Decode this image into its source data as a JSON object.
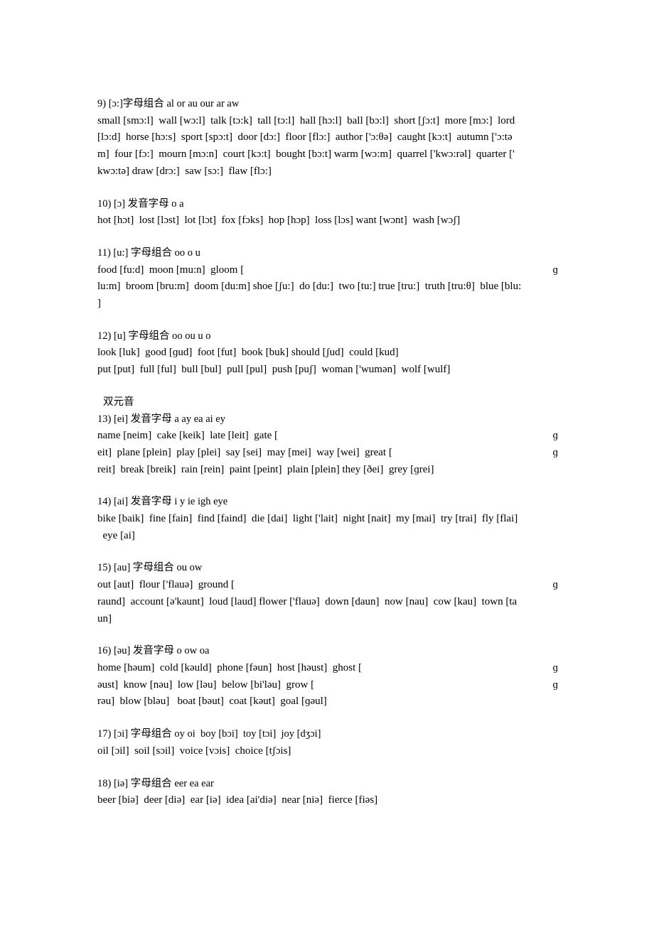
{
  "document": {
    "group_label": "双元音",
    "sections": [
      {
        "id": "sec-9",
        "heading": "9) [ɔ:]字母组合 al or au our ar aw",
        "lines": [
          {
            "text": "small [smɔ:l]  wall [wɔ:l]  talk [tɔ:k]  tall [tɔ:l]  hall [hɔ:l]  ball [bɔ:l]  short [ʃɔ:t]  more [mɔ:]  lord",
            "right": ""
          },
          {
            "text": "[lɔ:d]  horse [hɔ:s]  sport [spɔ:t]  door [dɔ:]  floor [flɔ:]  author ['ɔ:θə]  caught [kɔ:t]  autumn ['ɔ:tə",
            "right": ""
          },
          {
            "text": "m]  four [fɔ:]  mourn [mɔ:n]  court [kɔ:t]  bought [bɔ:t] warm [wɔ:m]  quarrel ['kwɔ:rəl]  quarter ['",
            "right": ""
          },
          {
            "text": "kwɔ:tə] draw [drɔ:]  saw [sɔ:]  flaw [flɔ:]",
            "right": ""
          }
        ]
      },
      {
        "id": "sec-10",
        "heading": "10) [ɔ] 发音字母 o a",
        "lines": [
          {
            "text": "hot [hɔt]  lost [lɔst]  lot [lɔt]  fox [fɔks]  hop [hɔp]  loss [lɔs] want [wɔnt]  wash [wɔʃ]",
            "right": ""
          }
        ]
      },
      {
        "id": "sec-11",
        "heading": "11) [u:] 字母组合 oo o u",
        "lines": [
          {
            "text": "food [fu:d]  moon [mu:n]  gloom [",
            "right": "ɡ"
          },
          {
            "text": "lu:m]  broom [bru:m]  doom [du:m] shoe [ʃu:]  do [du:]  two [tu:] true [tru:]  truth [tru:θ]  blue [blu:",
            "right": ""
          },
          {
            "text": "]",
            "right": ""
          }
        ]
      },
      {
        "id": "sec-12",
        "heading": "12) [u] 字母组合 oo ou u o",
        "lines": [
          {
            "text": "look [luk]  good [ɡud]  foot [fut]  book [buk] should [ʃud]  could [kud]",
            "right": ""
          },
          {
            "text": "put [put]  full [ful]  bull [bul]  pull [pul]  push [puʃ]  woman ['wumən]  wolf [wulf]",
            "right": ""
          }
        ]
      },
      {
        "id": "sec-13",
        "heading": "13) [ei] 发音字母 a ay ea ai ey",
        "lines": [
          {
            "text": "name [neim]  cake [keik]  late [leit]  gate [",
            "right": "ɡ"
          },
          {
            "text": "eit]  plane [plein]  play [plei]  say [sei]  may [mei]  way [wei]  great [",
            "right": "ɡ"
          },
          {
            "text": "reit]  break [breik]  rain [rein]  paint [peint]  plain [plein] they [ðei]  grey [ɡrei]",
            "right": ""
          }
        ]
      },
      {
        "id": "sec-14",
        "heading": "14) [ai] 发音字母 i y ie igh eye",
        "lines": [
          {
            "text": "bike [baik]  fine [fain]  find [faind]  die [dai]  light ['lait]  night [nait]  my [mai]  try [trai]  fly [flai]",
            "right": ""
          },
          {
            "text": "  eye [ai]",
            "right": ""
          }
        ]
      },
      {
        "id": "sec-15",
        "heading": "15) [au] 字母组合 ou ow",
        "lines": [
          {
            "text": "out [aut]  flour ['flauə]  ground [",
            "right": "ɡ"
          },
          {
            "text": "raund]  account [ə'kaunt]  loud [laud] flower ['flauə]  down [daun]  now [nau]  cow [kau]  town [ta",
            "right": ""
          },
          {
            "text": "un]",
            "right": ""
          }
        ]
      },
      {
        "id": "sec-16",
        "heading": "16) [əu] 发音字母 o ow oa",
        "lines": [
          {
            "text": "home [həum]  cold [kəuld]  phone [fəun]  host [həust]  ghost [",
            "right": "ɡ"
          },
          {
            "text": "əust]  know [nəu]  low [ləu]  below [bi'ləu]  grow [",
            "right": "ɡ"
          },
          {
            "text": "rəu]  blow [bləu]   boat [bəut]  coat [kəut]  goal [ɡəul]",
            "right": ""
          }
        ]
      },
      {
        "id": "sec-17",
        "heading": "17) [ɔi] 字母组合 oy oi  boy [bɔi]  toy [tɔi]  joy [dʒɔi]",
        "lines": [
          {
            "text": "oil [ɔil]  soil [sɔil]  voice [vɔis]  choice [tʃɔis]",
            "right": ""
          }
        ]
      },
      {
        "id": "sec-18",
        "heading": "18) [iə] 字母组合 eer ea ear",
        "lines": [
          {
            "text": "beer [biə]  deer [diə]  ear [iə]  idea [ai'diə]  near [niə]  fierce [fiəs]",
            "right": ""
          }
        ]
      }
    ]
  }
}
